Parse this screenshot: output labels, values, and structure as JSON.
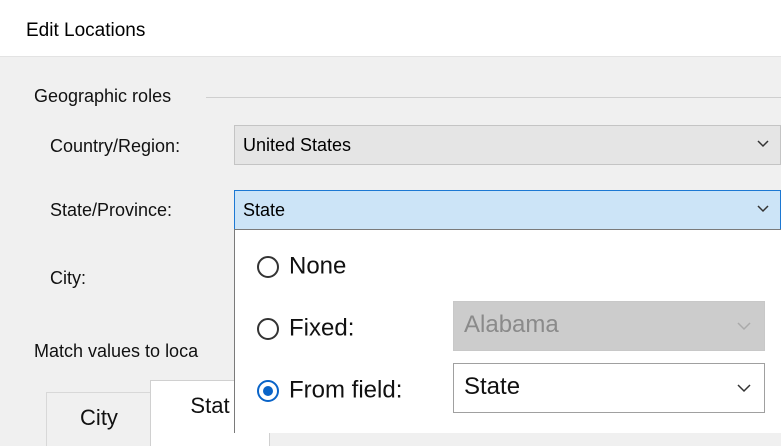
{
  "dialog": {
    "title": "Edit Locations"
  },
  "geo": {
    "group_label": "Geographic roles",
    "country": {
      "label": "Country/Region:",
      "value": "United States"
    },
    "state": {
      "label": "State/Province:",
      "value": "State"
    },
    "city": {
      "label": "City:"
    }
  },
  "match": {
    "label": "Match values to loca",
    "tabs": [
      {
        "label": "City"
      },
      {
        "label": "Stat"
      }
    ]
  },
  "dropdown": {
    "options": [
      {
        "label": "None",
        "selected": false
      },
      {
        "label": "Fixed:",
        "selected": false,
        "value": "Alabama",
        "disabled": true
      },
      {
        "label": "From field:",
        "selected": true,
        "value": "State"
      }
    ]
  },
  "colors": {
    "accent": "#0a64c8",
    "active_bg": "#cce4f7",
    "active_border": "#1c78d3"
  }
}
